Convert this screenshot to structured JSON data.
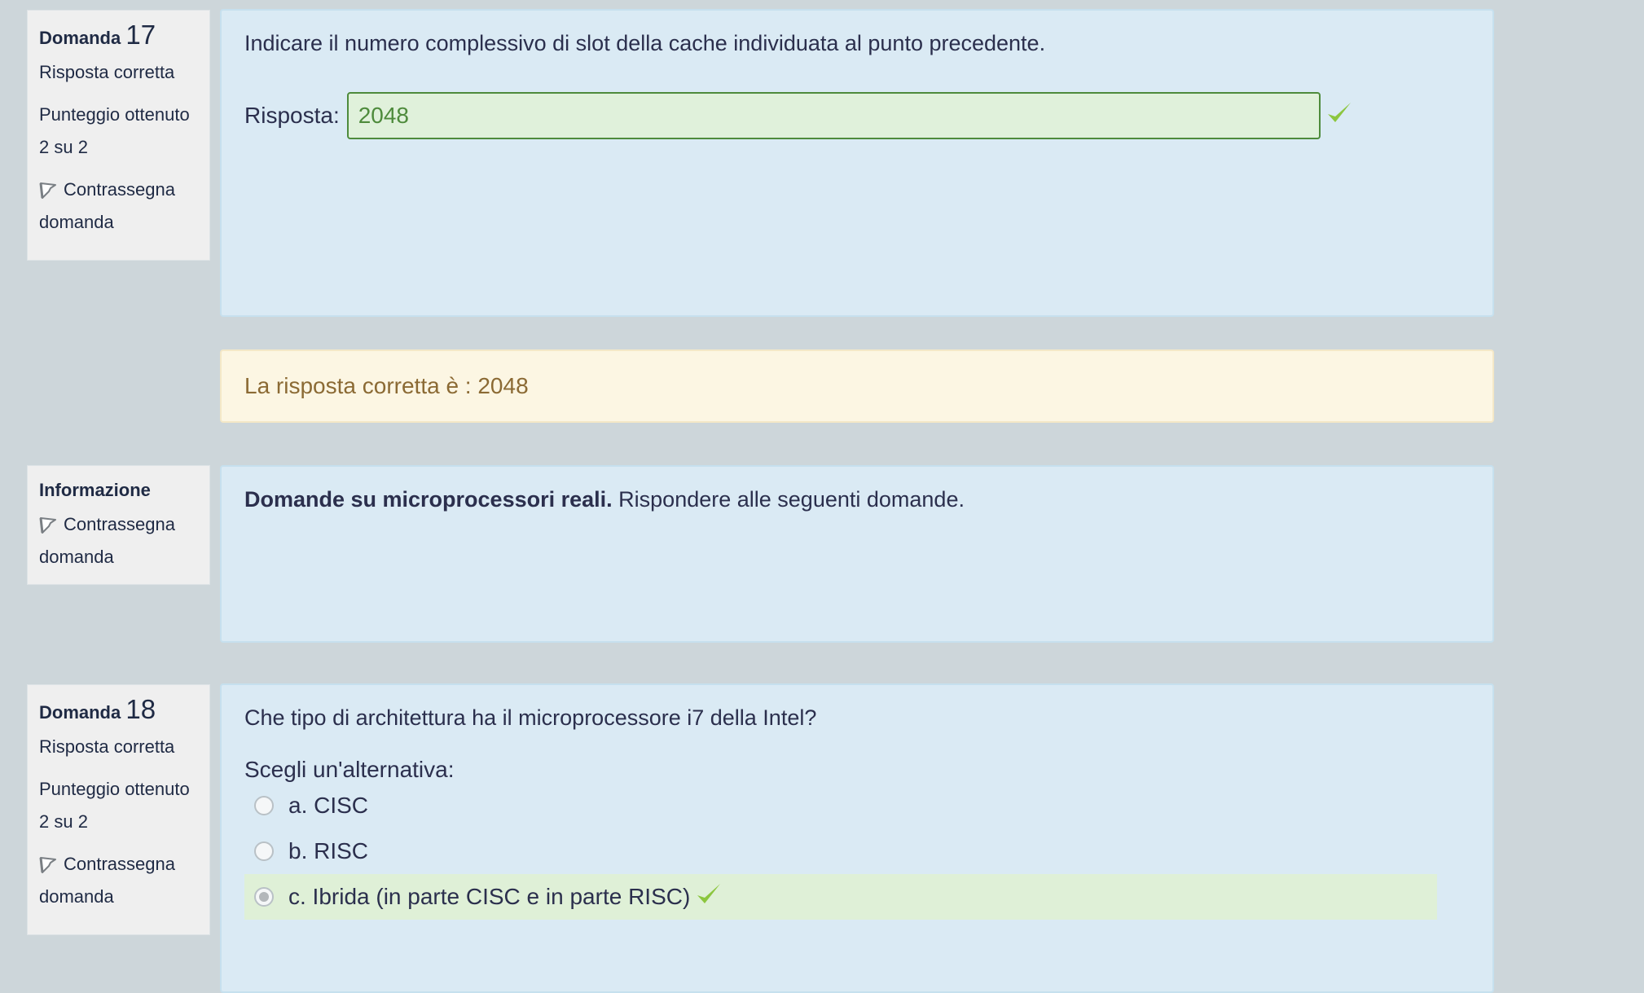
{
  "q17": {
    "label": "Domanda",
    "number": "17",
    "state": "Risposta corretta",
    "grade_line1": "Punteggio ottenuto",
    "grade_line2": "2 su 2",
    "flag": "Contrassegna domanda",
    "text": "Indicare il numero complessivo di slot della cache individuata al punto precedente.",
    "answer_label": "Risposta:",
    "answer_value": "2048",
    "right_answer": "La risposta corretta è : 2048"
  },
  "info": {
    "label": "Informazione",
    "flag": "Contrassegna domanda",
    "text_bold": "Domande su microprocessori reali.",
    "text_rest": " Rispondere alle seguenti domande."
  },
  "q18": {
    "label": "Domanda",
    "number": "18",
    "state": "Risposta corretta",
    "grade_line1": "Punteggio ottenuto",
    "grade_line2": "2 su 2",
    "flag": "Contrassegna domanda",
    "text": "Che tipo di architettura ha il microprocessore i7 della Intel?",
    "prompt": "Scegli un'alternativa:",
    "options": [
      {
        "label": "a. CISC",
        "selected": false
      },
      {
        "label": "b. RISC",
        "selected": false
      },
      {
        "label": "c. Ibrida (in parte CISC e in parte RISC)",
        "selected": true
      }
    ]
  },
  "colors": {
    "page_bg": "#cdd6da",
    "content_bg": "#daeaf4",
    "correct_bg": "#e0f1db",
    "correct_border": "#4e8b3c",
    "check": "#8cc63f",
    "outcome_bg": "#fcf6e3",
    "outcome_text": "#8b6a34"
  },
  "icons": [
    "flag-icon",
    "check-icon",
    "radio-icon"
  ]
}
